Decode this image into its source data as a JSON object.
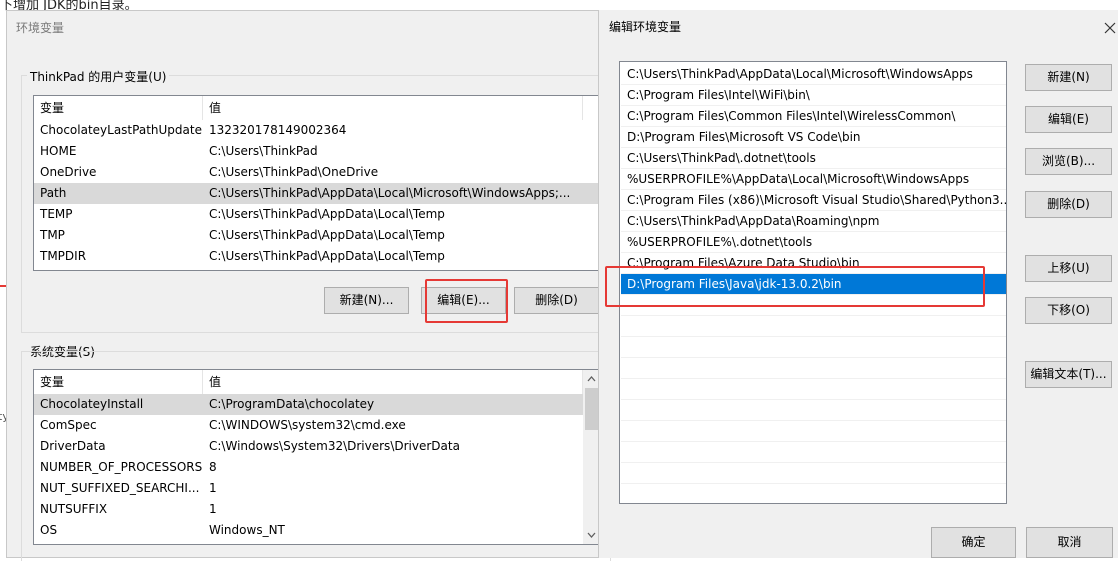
{
  "background": {
    "caption": "下增加 JDK的bin目录。"
  },
  "env_dialog": {
    "title": "环境变量",
    "user_group_label": "ThinkPad 的用户变量(U)",
    "system_group_label": "系统变量(S)",
    "columns": {
      "name": "变量",
      "value": "值"
    },
    "user_vars": [
      {
        "name": "ChocolateyLastPathUpdate",
        "value": "132320178149002364"
      },
      {
        "name": "HOME",
        "value": "C:\\Users\\ThinkPad"
      },
      {
        "name": "OneDrive",
        "value": "C:\\Users\\ThinkPad\\OneDrive"
      },
      {
        "name": "Path",
        "value": "C:\\Users\\ThinkPad\\AppData\\Local\\Microsoft\\WindowsApps;..."
      },
      {
        "name": "TEMP",
        "value": "C:\\Users\\ThinkPad\\AppData\\Local\\Temp"
      },
      {
        "name": "TMP",
        "value": "C:\\Users\\ThinkPad\\AppData\\Local\\Temp"
      },
      {
        "name": "TMPDIR",
        "value": "C:\\Users\\ThinkPad\\AppData\\Local\\Temp"
      }
    ],
    "user_selected_index": 3,
    "user_buttons": {
      "new": "新建(N)...",
      "edit": "编辑(E)...",
      "delete": "删除(D)"
    },
    "system_vars": [
      {
        "name": "ChocolateyInstall",
        "value": "C:\\ProgramData\\chocolatey"
      },
      {
        "name": "ComSpec",
        "value": "C:\\WINDOWS\\system32\\cmd.exe"
      },
      {
        "name": "DriverData",
        "value": "C:\\Windows\\System32\\Drivers\\DriverData"
      },
      {
        "name": "NUMBER_OF_PROCESSORS",
        "value": "8"
      },
      {
        "name": "NUT_SUFFIXED_SEARCHI...",
        "value": "1"
      },
      {
        "name": "NUTSUFFIX",
        "value": "1"
      },
      {
        "name": "OS",
        "value": "Windows_NT"
      }
    ],
    "system_selected_index": 0
  },
  "edit_dialog": {
    "title": "编辑环境变量",
    "paths": [
      "C:\\Users\\ThinkPad\\AppData\\Local\\Microsoft\\WindowsApps",
      "C:\\Program Files\\Intel\\WiFi\\bin\\",
      "C:\\Program Files\\Common Files\\Intel\\WirelessCommon\\",
      "D:\\Program Files\\Microsoft VS Code\\bin",
      "C:\\Users\\ThinkPad\\.dotnet\\tools",
      "%USERPROFILE%\\AppData\\Local\\Microsoft\\WindowsApps",
      "C:\\Program Files (x86)\\Microsoft Visual Studio\\Shared\\Python3...",
      "C:\\Users\\ThinkPad\\AppData\\Roaming\\npm",
      "%USERPROFILE%\\.dotnet\\tools",
      "C:\\Program Files\\Azure Data Studio\\bin",
      "D:\\Program Files\\Java\\jdk-13.0.2\\bin"
    ],
    "selected_index": 10,
    "buttons": {
      "new": "新建(N)",
      "edit": "编辑(E)",
      "browse": "浏览(B)...",
      "delete": "删除(D)",
      "move_up": "上移(U)",
      "move_down": "下移(O)",
      "edit_text": "编辑文本(T)...",
      "ok": "确定",
      "cancel": "取消"
    }
  },
  "colors": {
    "annotation_red": "#e53935",
    "selection_blue": "#0078d7"
  }
}
